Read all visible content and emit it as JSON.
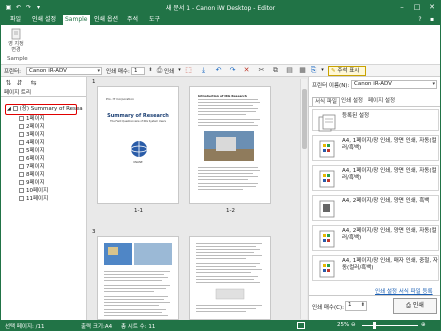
{
  "window": {
    "title": "새 문서 1 - Canon iW Desktop - Editor"
  },
  "quick_access": [
    "save-icon",
    "undo-icon",
    "redo-icon",
    "dropdown-icon"
  ],
  "title_buttons": [
    "minimize-icon",
    "maximize-icon",
    "close-icon"
  ],
  "menu": {
    "items": [
      "파일",
      "인쇄 설정",
      "Sample",
      "인쇄 옵션",
      "주석",
      "도구"
    ],
    "active_index": 2,
    "help_icons": [
      "help-icon",
      "info-icon"
    ]
  },
  "ribbon": {
    "group_label": "Sample",
    "button_label": "영 지정\n변경"
  },
  "toolbar": {
    "printer_label": "프린터:",
    "printer_value": "Canon iR-ADV",
    "copies_label": "인쇄 매수:",
    "copies_value": "1",
    "print_label": "인쇄",
    "annotation_label": "주석 표시"
  },
  "left_pane": {
    "header": "페이지 트리",
    "root_item": "(장) Summary of Resea",
    "pages": [
      "1페이지",
      "2페이지",
      "3페이지",
      "4페이지",
      "5페이지",
      "6페이지",
      "7페이지",
      "8페이지",
      "9페이지",
      "10페이지",
      "11페이지"
    ]
  },
  "center": {
    "groups": [
      {
        "number": "1",
        "captions": [
          "1-1",
          "1-2"
        ]
      },
      {
        "number": "3",
        "captions": [
          "",
          ""
        ]
      }
    ],
    "page1": {
      "corp": "Pro. IT Corporation",
      "heading": "Summary of Research",
      "subheading": "The Field Questionnaire of IRG System Users",
      "footer": "KNLINE"
    },
    "page2": {
      "heading": "Introduction of IRG Research"
    }
  },
  "right_pane": {
    "printer_label": "프린터 이름(N):",
    "printer_value": "Canon iR-ADV",
    "tabs": [
      "서식 파일",
      "인쇄 설정",
      "페이지 설정"
    ],
    "active_tab": 0,
    "profiles": [
      "등록된 설정",
      "A4, 1페이지/장 인쇄, 양면 인쇄, 자동(컬러/흑백)",
      "A4, 1페이지/장 인쇄, 양면 인쇄, 자동(컬러/흑백)",
      "A4, 2페이지/장 인쇄, 양면 인쇄, 흑백",
      "A4, 2페이지/장 인쇄, 양면 인쇄, 자동(컬러/흑백)",
      "A4, 1페이지/장 인쇄, 매자 인쇄, 중철, 자동(컬러/흑백)"
    ],
    "link": "인쇄 설정 서식 파일 등록",
    "copies_label": "인쇄 매수(C):",
    "copies_value": "1",
    "print_button": "인쇄"
  },
  "status": {
    "selected": "선택 페이지: /11",
    "output_size": "출력 크기:A4",
    "total": "총 시트 수: 11",
    "zoom": "25%"
  },
  "colors": {
    "accent": "#217346",
    "highlight": "#e00000"
  }
}
